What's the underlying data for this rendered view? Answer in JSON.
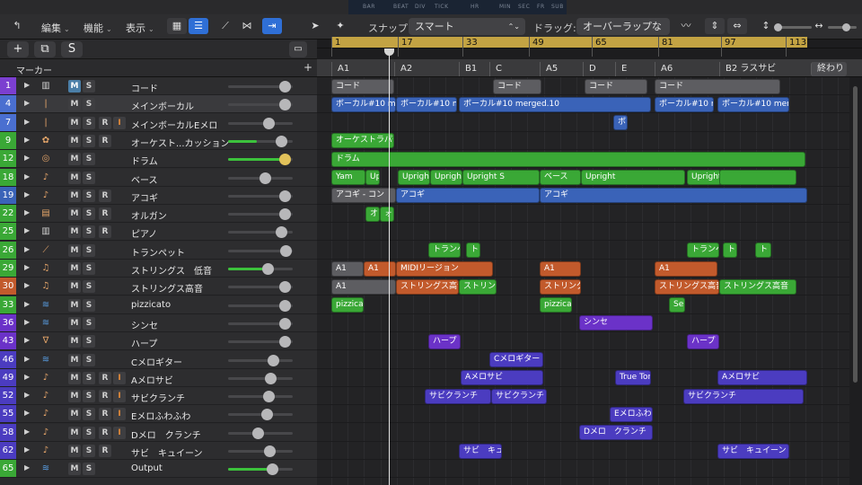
{
  "lcd": {
    "labels": [
      "BAR",
      "BEAT",
      "DIV",
      "TICK",
      "HR",
      "MIN",
      "SEC",
      "FR",
      "SUB"
    ]
  },
  "toolbar": {
    "menus": [
      "編集",
      "機能",
      "表示"
    ],
    "snap_label": "スナップ:",
    "snap_value": "スマート",
    "drag_label": "ドラッグ:",
    "drag_value": "オーバーラップなし"
  },
  "header": {
    "add_label": "+",
    "s_label": "S"
  },
  "marker_header": {
    "label": "マーカー",
    "add": "+"
  },
  "ruler": {
    "bars": [
      "1",
      "17",
      "33",
      "49",
      "65",
      "81",
      "97",
      "113"
    ]
  },
  "markers": [
    "A1",
    "A2",
    "B1",
    "C",
    "A5",
    "D",
    "E",
    "A6",
    "B2 ラスサビ",
    "終わり"
  ],
  "button_labels": {
    "m": "M",
    "s": "S",
    "r": "R",
    "i": "I"
  },
  "tracks": [
    {
      "num": "1",
      "name": "コード",
      "color": "#7b3fd0",
      "icon": "piano-icon"
    },
    {
      "num": "4",
      "name": "メインボーカル",
      "color": "#4a6fd0",
      "icon": "mic-icon"
    },
    {
      "num": "7",
      "name": "メインボーカルEメロ",
      "color": "#4a6fd0",
      "icon": "mic-icon"
    },
    {
      "num": "9",
      "name": "オーケスト...カッション",
      "color": "#3aa836",
      "icon": "percussion-icon"
    },
    {
      "num": "12",
      "name": "ドラム",
      "color": "#3aa836",
      "icon": "drum-icon"
    },
    {
      "num": "18",
      "name": "ベース",
      "color": "#3aa836",
      "icon": "bass-icon"
    },
    {
      "num": "19",
      "name": "アコギ",
      "color": "#3a63b8",
      "icon": "guitar-icon"
    },
    {
      "num": "22",
      "name": "オルガン",
      "color": "#3aa836",
      "icon": "organ-icon"
    },
    {
      "num": "25",
      "name": "ピアノ",
      "color": "#3aa836",
      "icon": "piano-icon"
    },
    {
      "num": "26",
      "name": "トランペット",
      "color": "#3aa836",
      "icon": "trumpet-icon"
    },
    {
      "num": "29",
      "name": "ストリングス　低音",
      "color": "#3aa836",
      "icon": "strings-icon"
    },
    {
      "num": "30",
      "name": "ストリングス高音",
      "color": "#c25a2c",
      "icon": "strings-icon"
    },
    {
      "num": "33",
      "name": "pizzicato",
      "color": "#3aa836",
      "icon": "waveform-icon"
    },
    {
      "num": "36",
      "name": "シンセ",
      "color": "#6b32c8",
      "icon": "waveform-icon"
    },
    {
      "num": "43",
      "name": "ハープ",
      "color": "#6b32c8",
      "icon": "harp-icon"
    },
    {
      "num": "46",
      "name": "Cメロギター",
      "color": "#4b3cc0",
      "icon": "waveform-icon"
    },
    {
      "num": "49",
      "name": "Aメロサビ",
      "color": "#4b3cc0",
      "icon": "guitar-icon"
    },
    {
      "num": "52",
      "name": "サビクランチ",
      "color": "#4b3cc0",
      "icon": "guitar-icon"
    },
    {
      "num": "55",
      "name": "Eメロふわふわ",
      "color": "#4b3cc0",
      "icon": "guitar-icon"
    },
    {
      "num": "58",
      "name": "Dメロ　クランチ",
      "color": "#4b3cc0",
      "icon": "guitar-icon"
    },
    {
      "num": "62",
      "name": "サビ　キュイーン",
      "color": "#4b3cc0",
      "icon": "guitar-icon"
    },
    {
      "num": "65",
      "name": "Output",
      "color": "#3aa836",
      "icon": "waveform-icon"
    }
  ],
  "regions": {
    "t0": [
      "コード",
      "コード",
      "コード",
      "コード"
    ],
    "t1": [
      "ボーカル#10 mer",
      "ボーカル#10 mer",
      "ボーカル#10 merged.10",
      "ボーカル#10 mer",
      "ボーカル#10 merge"
    ],
    "t2": [
      "ボ"
    ],
    "t3": [
      "オーケストラパー"
    ],
    "t4": [
      "ドラム"
    ],
    "t5": [
      "Yam",
      "Upright",
      "Upright",
      "Upright Studio Bass",
      "Upright S",
      "ベース",
      "Upright",
      "Upright Studio Bass"
    ],
    "t6": [
      "アコギ - コン",
      "アコギ",
      "アコギ"
    ],
    "t7": [
      "オ",
      "ォ"
    ],
    "t9": [
      "トランペ",
      "ト",
      "トランペ",
      "ト",
      "ト"
    ],
    "t10": [
      "A1",
      "A1",
      "MIDIリージョン",
      "A1",
      "A1"
    ],
    "t11": [
      "A1",
      "ストリングス高音",
      "ストリン",
      "ストリング",
      "ストリングス高音",
      "ストリングス高音"
    ],
    "t12": [
      "pizzicat",
      "pizzicat",
      "Se"
    ],
    "t13": [
      "シンセ"
    ],
    "t14": [
      "ハープ",
      "ハープ"
    ],
    "t15": [
      "Cメロギター"
    ],
    "t16": [
      "Aメロサビ",
      "True Ton",
      "Aメロサビ"
    ],
    "t17": [
      "サビクランチ",
      "サビクランチ",
      "サビクランチ"
    ],
    "t18": [
      "Eメロふわふわ"
    ],
    "t19": [
      "Dメロ　クランチ"
    ],
    "t20": [
      "サビ　キュ",
      "サビ　キュイーン"
    ]
  },
  "colors": {
    "accent": "#2f6fd6",
    "cycle": "#c3a343",
    "mute_on": "#4b7fa8"
  }
}
